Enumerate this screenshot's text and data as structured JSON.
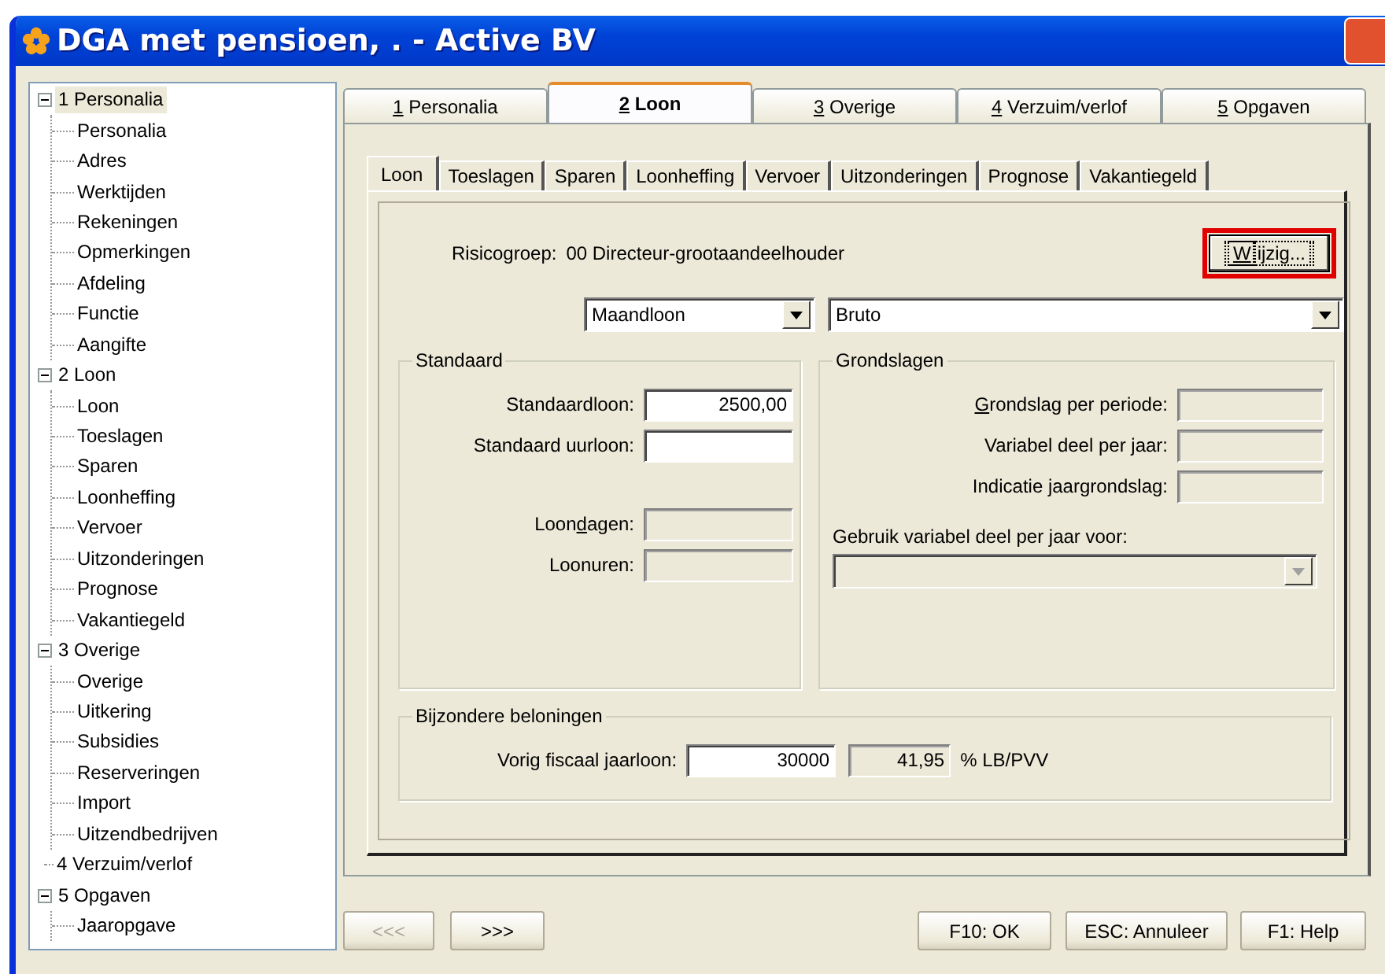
{
  "window": {
    "title": "DGA met pensioen, . - Active BV"
  },
  "tree": [
    {
      "label": "1 Personalia",
      "expanded": true,
      "selected": true,
      "children": [
        {
          "label": "Personalia",
          "selected": false
        },
        {
          "label": "Adres",
          "selected": false
        },
        {
          "label": "Werktijden",
          "selected": false
        },
        {
          "label": "Rekeningen",
          "selected": false
        },
        {
          "label": "Opmerkingen",
          "selected": false
        },
        {
          "label": "Afdeling",
          "selected": false
        },
        {
          "label": "Functie",
          "selected": false
        },
        {
          "label": "Aangifte",
          "selected": false
        }
      ]
    },
    {
      "label": "2 Loon",
      "expanded": true,
      "selected": false,
      "children": [
        {
          "label": "Loon",
          "selected": false
        },
        {
          "label": "Toeslagen",
          "selected": false
        },
        {
          "label": "Sparen",
          "selected": false
        },
        {
          "label": "Loonheffing",
          "selected": false
        },
        {
          "label": "Vervoer",
          "selected": false
        },
        {
          "label": "Uitzonderingen",
          "selected": false
        },
        {
          "label": "Prognose",
          "selected": false
        },
        {
          "label": "Vakantiegeld",
          "selected": false
        }
      ]
    },
    {
      "label": "3 Overige",
      "expanded": true,
      "selected": false,
      "children": [
        {
          "label": "Overige",
          "selected": false
        },
        {
          "label": "Uitkering",
          "selected": false
        },
        {
          "label": "Subsidies",
          "selected": false
        },
        {
          "label": "Reserveringen",
          "selected": false
        },
        {
          "label": "Import",
          "selected": false
        },
        {
          "label": "Uitzendbedrijven",
          "selected": false
        }
      ]
    },
    {
      "label": "4 Verzuim/verlof",
      "selected": false
    },
    {
      "label": "5 Opgaven",
      "expanded": true,
      "selected": false,
      "children": [
        {
          "label": "Jaaropgave",
          "selected": false
        }
      ]
    }
  ],
  "main_tabs": [
    {
      "label": [
        {
          "text": "1",
          "underlined": true
        },
        {
          "text": " Personalia",
          "underlined": false
        }
      ],
      "selected": false
    },
    {
      "label": [
        {
          "text": "2",
          "underlined": true
        },
        {
          "text": " Loon",
          "underlined": false
        }
      ],
      "selected": true
    },
    {
      "label": [
        {
          "text": "3",
          "underlined": true
        },
        {
          "text": " Overige",
          "underlined": false
        }
      ],
      "selected": false
    },
    {
      "label": [
        {
          "text": "4",
          "underlined": true
        },
        {
          "text": " Verzuim/verlof",
          "underlined": false
        }
      ],
      "selected": false
    },
    {
      "label": [
        {
          "text": "5",
          "underlined": true
        },
        {
          "text": " Opgaven",
          "underlined": false
        }
      ],
      "selected": false
    }
  ],
  "sub_tabs": [
    {
      "label": "Loon",
      "selected": true
    },
    {
      "label": "Toeslagen",
      "selected": false
    },
    {
      "label": "Sparen",
      "selected": false
    },
    {
      "label": "Loonheffing",
      "selected": false
    },
    {
      "label": "Vervoer",
      "selected": false
    },
    {
      "label": "Uitzonderingen",
      "selected": false
    },
    {
      "label": "Prognose",
      "selected": false
    },
    {
      "label": "Vakantiegeld",
      "selected": false
    }
  ],
  "risk_group": {
    "label": "Risicogroep:",
    "value": "00 Directeur-grootaandeelhouder"
  },
  "change_button": {
    "label": [
      {
        "text": "W",
        "underlined": true
      },
      {
        "text": "ijzig...",
        "underlined": false
      }
    ],
    "highlighted": true
  },
  "dropdowns": [
    {
      "value": "Maandloon"
    },
    {
      "value": "Bruto"
    }
  ],
  "standaard": {
    "title": "Standaard",
    "rate_fields": [
      {
        "label": "Standaardloon:",
        "value": "2500,00",
        "disabled": false
      },
      {
        "label": "Standaard uurloon:",
        "disabled": false
      }
    ],
    "period_fields": [
      {
        "label": [
          {
            "text": "Loon",
            "underlined": false
          },
          {
            "text": "d",
            "underlined": true
          },
          {
            "text": "agen:",
            "underlined": false
          }
        ],
        "disabled": true
      },
      {
        "label": "Loonuren:",
        "disabled": true
      }
    ]
  },
  "grondslagen": {
    "title": "Grondslagen",
    "fields": [
      {
        "label": [
          {
            "text": "G",
            "underlined": true
          },
          {
            "text": "rondslag per periode:",
            "underlined": false
          }
        ],
        "disabled": true
      },
      {
        "label": "Variabel deel per jaar:",
        "disabled": true
      },
      {
        "label": "Indicatie jaargrondslag:",
        "disabled": true
      }
    ],
    "dropdown": {
      "label": "Gebruik variabel deel per jaar voor:",
      "disabled": true
    }
  },
  "bijzondere": {
    "title": "Bijzondere beloningen",
    "label": "Vorig fiscaal jaarloon:",
    "value": "30000",
    "percentage": "41,95",
    "unit": "% LB/PVV"
  },
  "buttons": [
    {
      "label": "<<<",
      "disabled": true
    },
    {
      "label": ">>>",
      "disabled": false
    },
    {
      "label": "F10: OK",
      "disabled": false
    },
    {
      "label": "ESC: Annuleer",
      "disabled": false
    },
    {
      "label": "F1: Help",
      "disabled": false
    }
  ]
}
